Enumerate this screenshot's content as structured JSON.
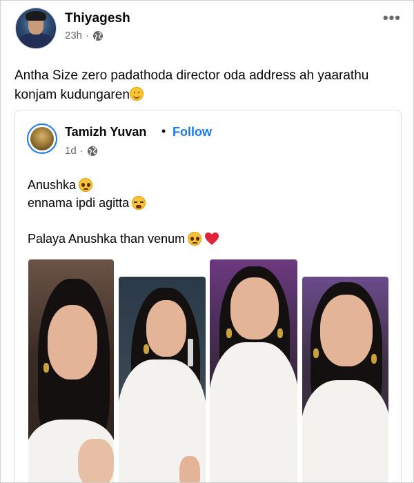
{
  "post": {
    "author": "Thiyagesh",
    "time": "23h",
    "separator": "·",
    "more_label": "•••",
    "text": "Antha Size zero padathoda director oda address ah yaarathu konjam kudungaren"
  },
  "shared_post": {
    "author": "Tamizh Yuvan",
    "dot": "•",
    "follow_label": "Follow",
    "time": "1d",
    "separator": "·",
    "lines": {
      "line1": "Anushka",
      "line2": "ennama ipdi agitta",
      "line3": "Palaya Anushka than venum"
    },
    "emoji": {
      "line1": "pleading-face",
      "line2": "sobbing-face",
      "line3": [
        "pleading-face",
        "red-heart"
      ]
    },
    "photo_count": 4
  },
  "icons": {
    "privacy": "globe-icon",
    "more": "more-options-icon"
  },
  "colors": {
    "link": "#1877f2",
    "meta": "#65676b",
    "text": "#050505"
  }
}
